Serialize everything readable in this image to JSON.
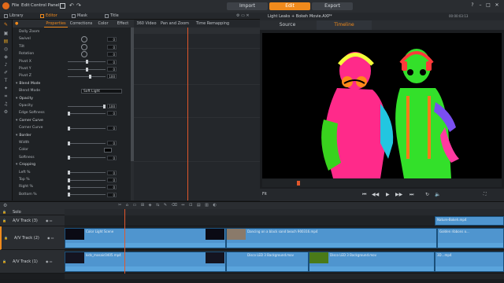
{
  "menu": {
    "file": "File",
    "edit": "Edit",
    "control_panel": "Control Panel"
  },
  "modes": {
    "import": "Import",
    "edit": "Edit",
    "export": "Export"
  },
  "panel_tabs": {
    "library": "Library",
    "editor": "Editor",
    "mask": "Mask",
    "title": "Title"
  },
  "editor_tabs": [
    "Properties",
    "Corrections",
    "Color",
    "Effect"
  ],
  "keyframe_tabs": [
    "360 Video",
    "Pan and Zoom",
    "Time Remapping"
  ],
  "properties": {
    "rows": [
      {
        "label": "Dolly Zoom",
        "kind": "label"
      },
      {
        "label": "Swivel",
        "kind": "dial",
        "value": "0"
      },
      {
        "label": "Tilt",
        "kind": "dial",
        "value": "0"
      },
      {
        "label": "Rotation",
        "kind": "dial",
        "value": "0"
      },
      {
        "label": "Pivot X",
        "kind": "slider",
        "value": "0",
        "pos": 0.5
      },
      {
        "label": "Pivot Y",
        "kind": "slider",
        "value": "0",
        "pos": 0.5
      },
      {
        "label": "Pivot Z",
        "kind": "slider",
        "value": "100",
        "pos": 0.6
      },
      {
        "label": "Blend Mode",
        "kind": "section"
      },
      {
        "label": "Blend Mode",
        "kind": "dropdown",
        "value": "Soft Light"
      },
      {
        "label": "Opacity",
        "kind": "section"
      },
      {
        "label": "Opacity",
        "kind": "slider",
        "value": "100",
        "pos": 1.0
      },
      {
        "label": "Edge Softness",
        "kind": "slider",
        "value": "0",
        "pos": 0.0
      },
      {
        "label": "Corner Curve",
        "kind": "section"
      },
      {
        "label": "Corner Curve",
        "kind": "slider",
        "value": "0",
        "pos": 0.0
      },
      {
        "label": "Border",
        "kind": "section"
      },
      {
        "label": "Width",
        "kind": "slider",
        "value": "0",
        "pos": 0.0
      },
      {
        "label": "Color",
        "kind": "color"
      },
      {
        "label": "Softness",
        "kind": "slider",
        "value": "0",
        "pos": 0.0
      },
      {
        "label": "Cropping",
        "kind": "section"
      },
      {
        "label": "Left %",
        "kind": "slider",
        "value": "0",
        "pos": 0.0
      },
      {
        "label": "Top %",
        "kind": "slider",
        "value": "0",
        "pos": 0.0
      },
      {
        "label": "Right %",
        "kind": "slider",
        "value": "0",
        "pos": 0.0
      },
      {
        "label": "Bottom %",
        "kind": "slider",
        "value": "0",
        "pos": 0.0
      }
    ]
  },
  "preview": {
    "title": "Light Leaks + Bokeh Movie.AXP*",
    "timecode": "00:00:03:13",
    "tabs": {
      "source": "Source",
      "timeline": "Timeline"
    },
    "fit": "Fit"
  },
  "timeline": {
    "tracks": [
      {
        "name": "Solo"
      },
      {
        "name": "A/V Track (3)"
      },
      {
        "name": "A/V Track (2)"
      },
      {
        "name": "A/V Track (1)"
      }
    ],
    "clips": {
      "t3": "Nature-Bokeh.mp4",
      "t2a": "Color Light Scene",
      "t2b": "Dancing on a black sand beach 900316.mp4",
      "t2c": "Golden ribbons o...",
      "t1a": "kids_mosaic0405.mp4",
      "t1b": "Disco LED 3 Background.mov",
      "t1c": "Disco LED 3 Background.mov",
      "t1d": "3D...mp4"
    }
  },
  "colors": {
    "accent": "#f08a1c",
    "playhead": "#e2572b",
    "clip": "#4f95cf"
  }
}
